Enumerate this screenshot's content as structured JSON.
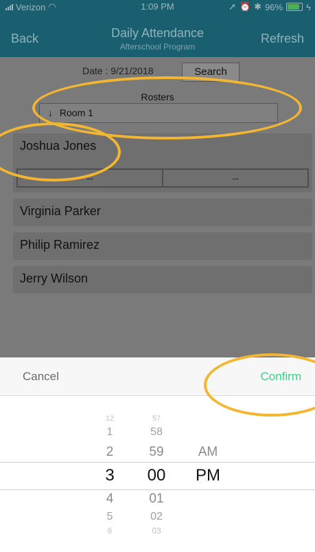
{
  "status_bar": {
    "carrier": "Verizon",
    "time": "1:09 PM",
    "battery": "96%"
  },
  "nav": {
    "back": "Back",
    "title": "Daily Attendance",
    "subtitle": "Afterschool Program",
    "refresh": "Refresh"
  },
  "date_label": "Date : 9/21/2018",
  "search_label": "Search",
  "rosters_label": "Rosters",
  "room_selector": {
    "arrow": "↓",
    "value": "Room 1"
  },
  "students": [
    {
      "name": "Joshua Jones",
      "status_in": "--",
      "status_out": "--"
    },
    {
      "name": "Virginia Parker"
    },
    {
      "name": "Philip Ramirez"
    },
    {
      "name": "Jerry Wilson"
    }
  ],
  "picker": {
    "cancel": "Cancel",
    "confirm": "Confirm",
    "hours": [
      "12",
      "1",
      "2",
      "3",
      "4",
      "5",
      "6"
    ],
    "minutes": [
      "57",
      "58",
      "59",
      "00",
      "01",
      "02",
      "03"
    ],
    "ampm": [
      "AM",
      "PM"
    ],
    "selected": {
      "hour": "3",
      "minute": "00",
      "period": "PM"
    }
  },
  "colors": {
    "nav_bg": "#1a5f70",
    "content_bg": "#7a7a7a",
    "confirm": "#3bd08a",
    "annotation": "#f2b632"
  }
}
